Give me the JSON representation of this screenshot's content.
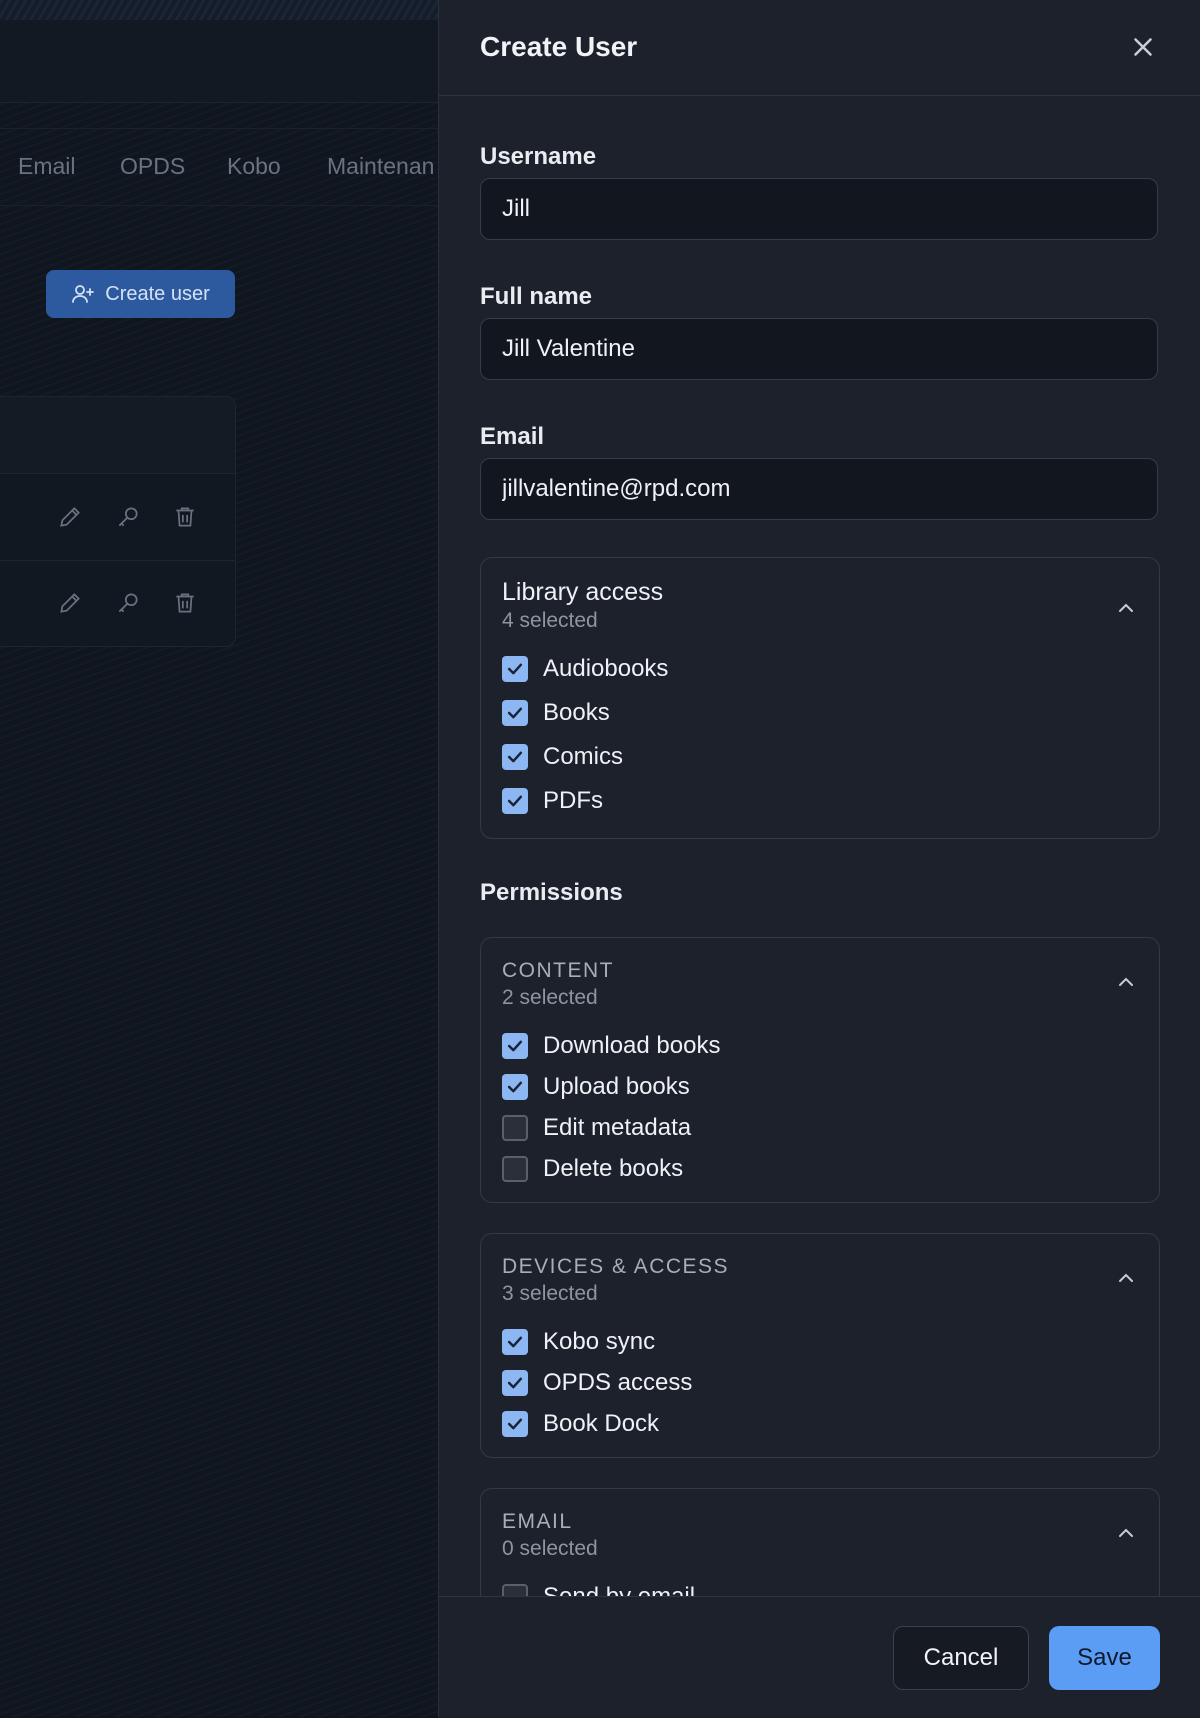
{
  "background": {
    "tabs": [
      "Email",
      "OPDS",
      "Kobo",
      "Maintenan"
    ],
    "create_user_label": "Create user",
    "row_actions": [
      "edit-icon",
      "key-icon",
      "trash-icon"
    ]
  },
  "drawer": {
    "title": "Create User",
    "close_icon": "close-icon"
  },
  "form": {
    "username_label": "Username",
    "username_value": "Jill",
    "fullname_label": "Full name",
    "fullname_value": "Jill Valentine",
    "email_label": "Email",
    "email_value": "jillvalentine@rpd.com"
  },
  "library_access": {
    "title": "Library access",
    "count": "4 selected",
    "items": [
      {
        "label": "Audiobooks",
        "checked": true
      },
      {
        "label": "Books",
        "checked": true
      },
      {
        "label": "Comics",
        "checked": true
      },
      {
        "label": "PDFs",
        "checked": true
      }
    ]
  },
  "permissions": {
    "label": "Permissions",
    "groups": [
      {
        "title": "CONTENT",
        "count": "2 selected",
        "items": [
          {
            "label": "Download books",
            "checked": true
          },
          {
            "label": "Upload books",
            "checked": true
          },
          {
            "label": "Edit metadata",
            "checked": false
          },
          {
            "label": "Delete books",
            "checked": false
          }
        ]
      },
      {
        "title": "DEVICES & ACCESS",
        "count": "3 selected",
        "items": [
          {
            "label": "Kobo sync",
            "checked": true
          },
          {
            "label": "OPDS access",
            "checked": true
          },
          {
            "label": "Book Dock",
            "checked": true
          }
        ]
      },
      {
        "title": "EMAIL",
        "count": "0 selected",
        "items": [
          {
            "label": "Send by email",
            "checked": false
          }
        ]
      }
    ]
  },
  "footer": {
    "cancel_label": "Cancel",
    "save_label": "Save"
  },
  "colors": {
    "accent": "#5b9cf5",
    "checkbox_checked": "#8cb7f2",
    "drawer_bg": "#1c212b",
    "page_bg": "#0f141c"
  }
}
